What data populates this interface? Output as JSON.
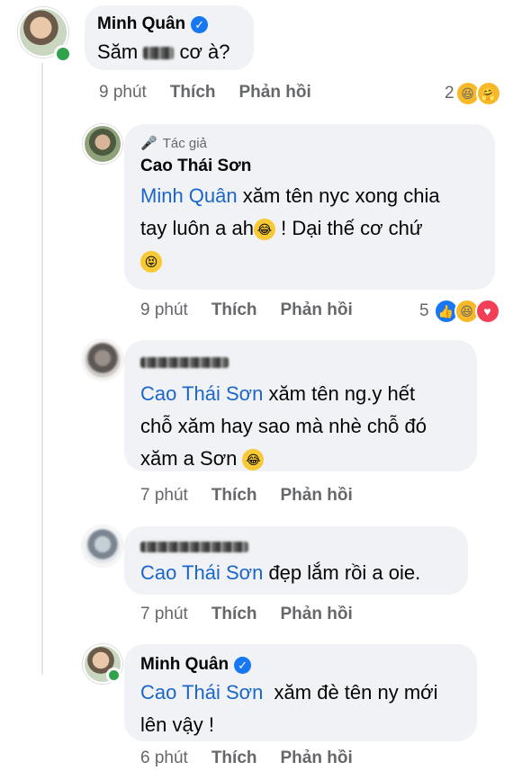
{
  "comments": [
    {
      "name": "Minh Quân",
      "text_before": "Săm",
      "text_after": "cơ à?",
      "time": "9 phút",
      "like": "Thích",
      "reply": "Phản hồi",
      "reaction_count": "2"
    },
    {
      "author_badge": "Tác giả",
      "name": "Cao Thái Sơn",
      "mention": "Minh Quân",
      "line1": " xăm tên nyc xong chia",
      "line2": "tay luôn a ah",
      "line2_after": " ! Dại thế cơ chứ",
      "time": "9 phút",
      "like": "Thích",
      "reply": "Phản hồi",
      "reaction_count": "5"
    },
    {
      "mention": "Cao Thái Sơn",
      "line1": " xăm tên ng.y hết",
      "line2": "chỗ xăm hay sao mà nhè chỗ đó",
      "line3": "xăm a Sơn",
      "time": "7 phút",
      "like": "Thích",
      "reply": "Phản hồi"
    },
    {
      "mention": "Cao Thái Sơn",
      "line1": " đẹp lắm rồi a oie.",
      "time": "7 phút",
      "like": "Thích",
      "reply": "Phản hồi"
    },
    {
      "name": "Minh Quân",
      "mention": "Cao Thái Sơn",
      "line1": "  xăm đè tên ny mới",
      "line2": "lên vậy !",
      "time": "6 phút",
      "like": "Thích",
      "reply": "Phản hồi"
    }
  ]
}
